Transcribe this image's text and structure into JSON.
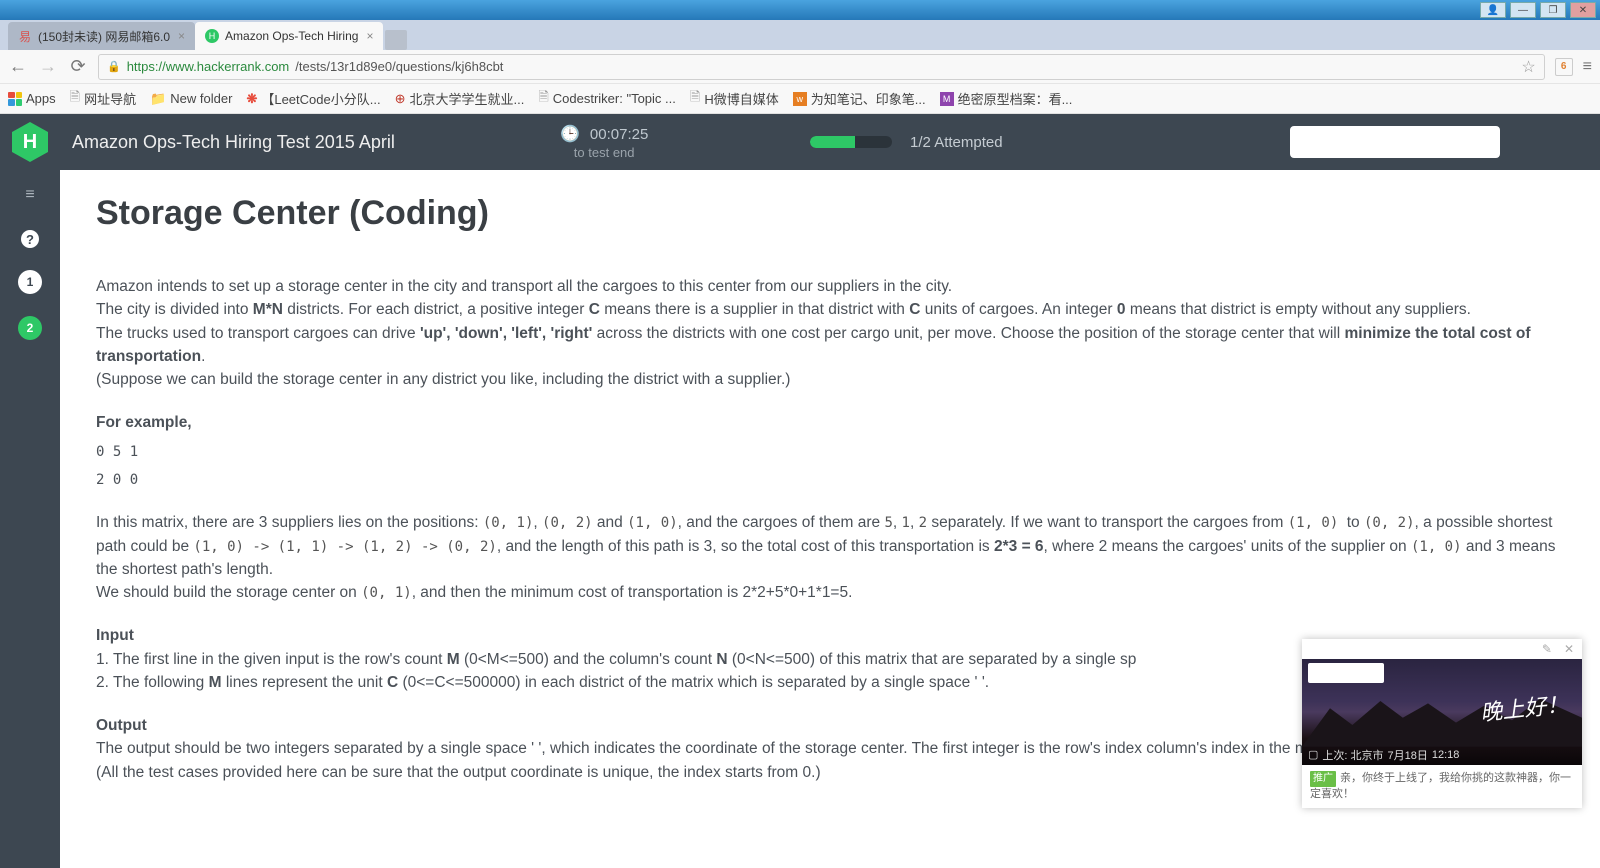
{
  "tabs": {
    "t1": "(150封未读) 网易邮箱6.0",
    "t2": "Amazon Ops-Tech Hiring"
  },
  "url": {
    "host": "https://www.hackerrank.com",
    "path": "/tests/13r1d89e0/questions/kj6h8cbt"
  },
  "bookmarks": {
    "apps": "Apps",
    "b1": "网址导航",
    "b2": "New folder",
    "b3": "【LeetCode小分队...",
    "b4": "北京大学学生就业...",
    "b5": "Codestriker: \"Topic ...",
    "b6": "H微博自媒体",
    "b7": "为知笔记、印象笔...",
    "b8": "绝密原型档案：看..."
  },
  "header": {
    "title": "Amazon Ops-Tech Hiring Test 2015 April",
    "timer": "00:07:25",
    "timer_sub": "to test end",
    "attempted": "1/2 Attempted",
    "logo": "H"
  },
  "sidebar": {
    "n1": "1",
    "n2": "2"
  },
  "question": {
    "title": "Storage Center (Coding)",
    "p1a": "Amazon intends to set up a storage center in the city and transport all the cargoes to this center from our suppliers in the city.",
    "p1b_1": "The city is divided into ",
    "p1b_mn": "M*N",
    "p1b_2": " districts. For each district, a positive integer ",
    "p1b_c": "C",
    "p1b_3": " means there is a supplier in that district with ",
    "p1b_c2": "C",
    "p1b_4": " units of cargoes. An integer ",
    "p1b_z": "0",
    "p1b_5": " means that district is empty without any suppliers.",
    "p1c_1": "The trucks used to transport cargoes can drive ",
    "p1c_dir": "'up', 'down', 'left', 'right'",
    "p1c_2": " across the districts with one cost per cargo unit, per move.  Choose the position of the storage center that will ",
    "p1c_bold": "minimize the total cost of transportation",
    "p1c_3": ".",
    "p1d": "(Suppose we can build the storage center in any district you like, including the district with a supplier.)",
    "example_label": "For example,",
    "matrix_r1": "0 5 1",
    "matrix_r2": "2 0 0",
    "ex_1": "In this matrix, there are 3 suppliers lies on the positions: ",
    "ex_c1": "(0, 1)",
    "ex_2": ",  ",
    "ex_c2": "(0, 2)",
    "ex_3": " and ",
    "ex_c3": "(1, 0)",
    "ex_4": ", and the cargoes of them are ",
    "ex_c4": "5",
    "ex_5": ", ",
    "ex_c5": "1",
    "ex_6": ", ",
    "ex_c6": "2",
    "ex_7": " separately. If we want to transport the cargoes from ",
    "ex_c7": " (1, 0) ",
    "ex_8": "to ",
    "ex_c8": "(0, 2)",
    "ex_9": ", a possible shortest path could be ",
    "ex_path": "(1, 0) -> (1, 1) -> (1, 2) -> (0, 2)",
    "ex_10": ", and the length of this path is 3, so the total cost of this transportation is ",
    "ex_bold": "2*3 = 6",
    "ex_11": ", where 2 means the cargoes' units of the supplier on ",
    "ex_c9": "(1, 0)",
    "ex_12": " and 3 means the shortest path's length.",
    "ex_13": "We should build the storage center on ",
    "ex_c10": "(0, 1)",
    "ex_14": ", and then the minimum cost of transportation is 2*2+5*0+1*1=5.",
    "input_h": "Input",
    "input_1a": "1. The first line in the given input is the row's count ",
    "input_m": "M",
    "input_1b": " (0<M<=500) and the column's count ",
    "input_n": "N",
    "input_1c": " (0<N<=500) of this matrix that are separated by a single sp",
    "input_2a": "2. The following ",
    "input_m2": "M",
    "input_2b": " lines represent the unit ",
    "input_c": "C",
    "input_2c": " (0<=C<=500000) in each district of the matrix which is separated by a single space ' '.",
    "output_h": "Output",
    "output_1": "The output should be two integers separated by a single space ' ', which indicates the coordinate of the storage center. The first integer is the row's index column's index in the matrix.",
    "output_2": "(All the test cases provided here can be sure that the output coordinate is unique, the index starts from 0.)"
  },
  "popup": {
    "greeting": "晚上好！",
    "loc_prefix": "上次: 北京市",
    "date": "7月18日",
    "time": "12:18",
    "ad_tag": "推广",
    "ad_text": "亲，你终于上线了，我给你挑的这款神器，你一定喜欢！"
  },
  "addr_badge": "6"
}
